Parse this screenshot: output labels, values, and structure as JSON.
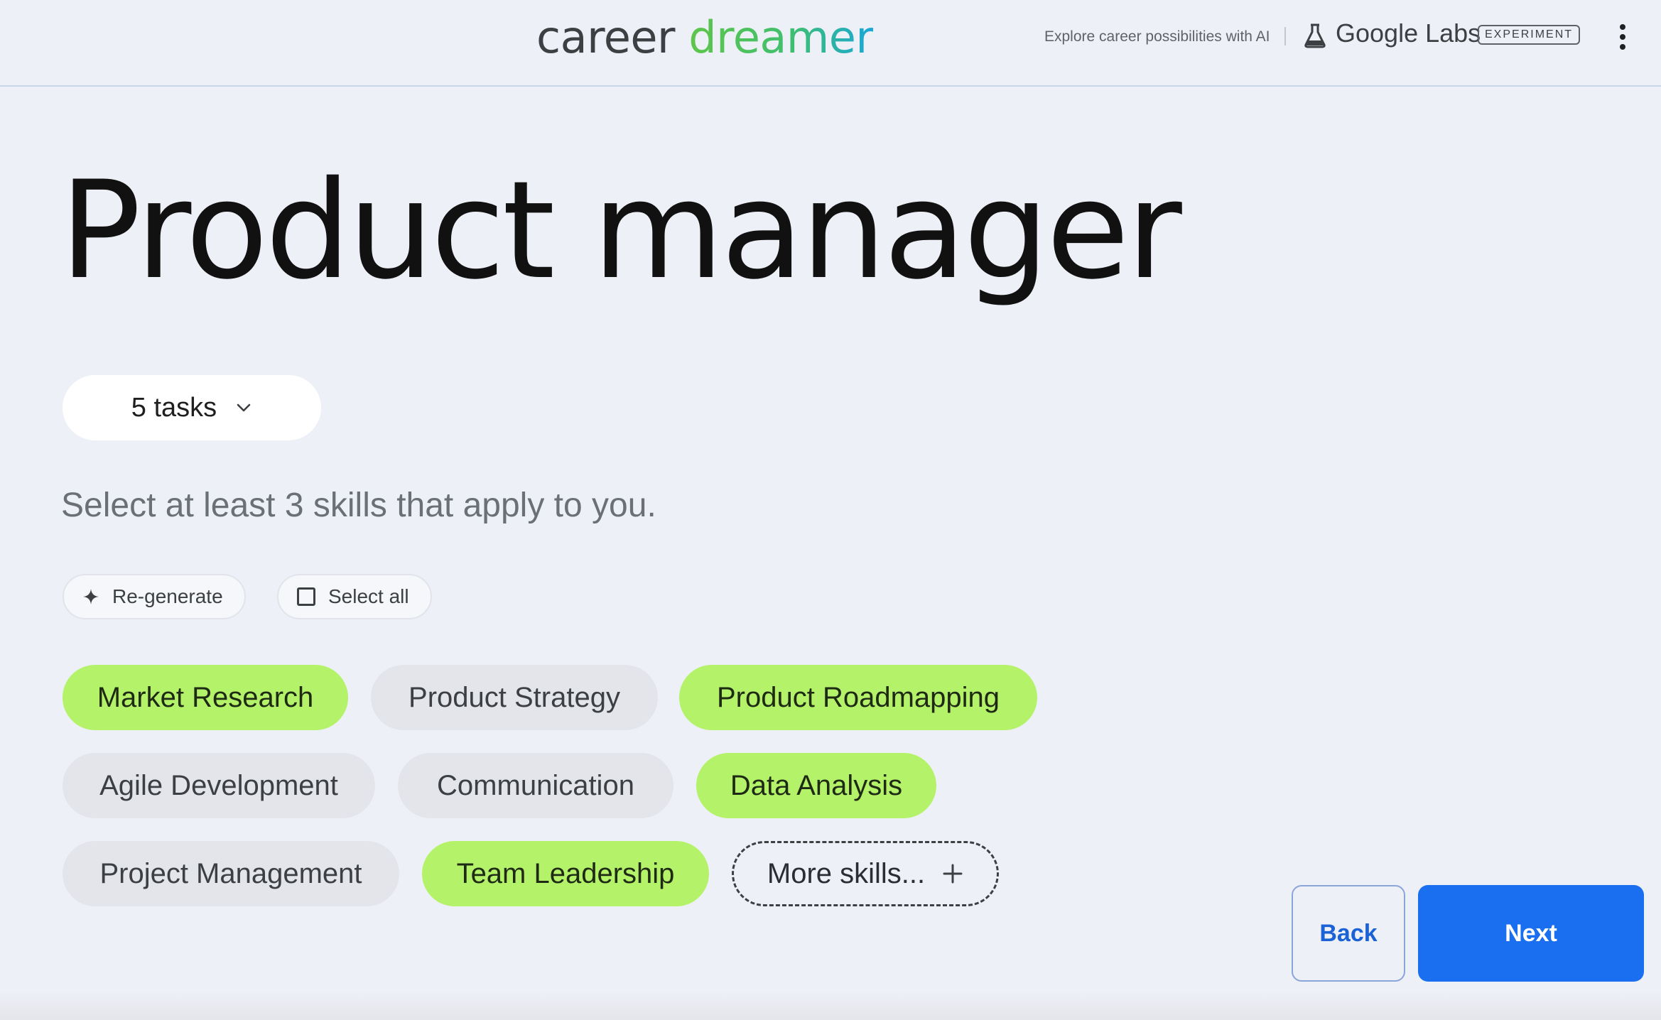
{
  "header": {
    "brand_part1": "career",
    "brand_part2": "dreamer",
    "tagline": "Explore career possibilities with AI",
    "labs_label": "Google Labs",
    "badge": "EXPERIMENT",
    "menu_icon": "more-vert-icon"
  },
  "page": {
    "title": "Product manager",
    "tasks_dropdown": "5 tasks",
    "instruction": "Select at least 3 skills that apply to you."
  },
  "actions": {
    "regenerate": "Re-generate",
    "select_all": "Select all"
  },
  "skills": [
    {
      "label": "Market Research",
      "selected": true
    },
    {
      "label": "Product Strategy",
      "selected": false
    },
    {
      "label": "Product Roadmapping",
      "selected": true
    },
    {
      "label": "Agile Development",
      "selected": false
    },
    {
      "label": "Communication",
      "selected": false
    },
    {
      "label": "Data Analysis",
      "selected": true
    },
    {
      "label": "Project Management",
      "selected": false
    },
    {
      "label": "Team Leadership",
      "selected": true
    }
  ],
  "more_skills": "More skills...",
  "nav": {
    "back": "Back",
    "next": "Next"
  },
  "colors": {
    "selected_chip": "#b4f26a",
    "unselected_chip": "#e3e5ea",
    "primary": "#1a6ff0",
    "background": "#eef0f7"
  }
}
